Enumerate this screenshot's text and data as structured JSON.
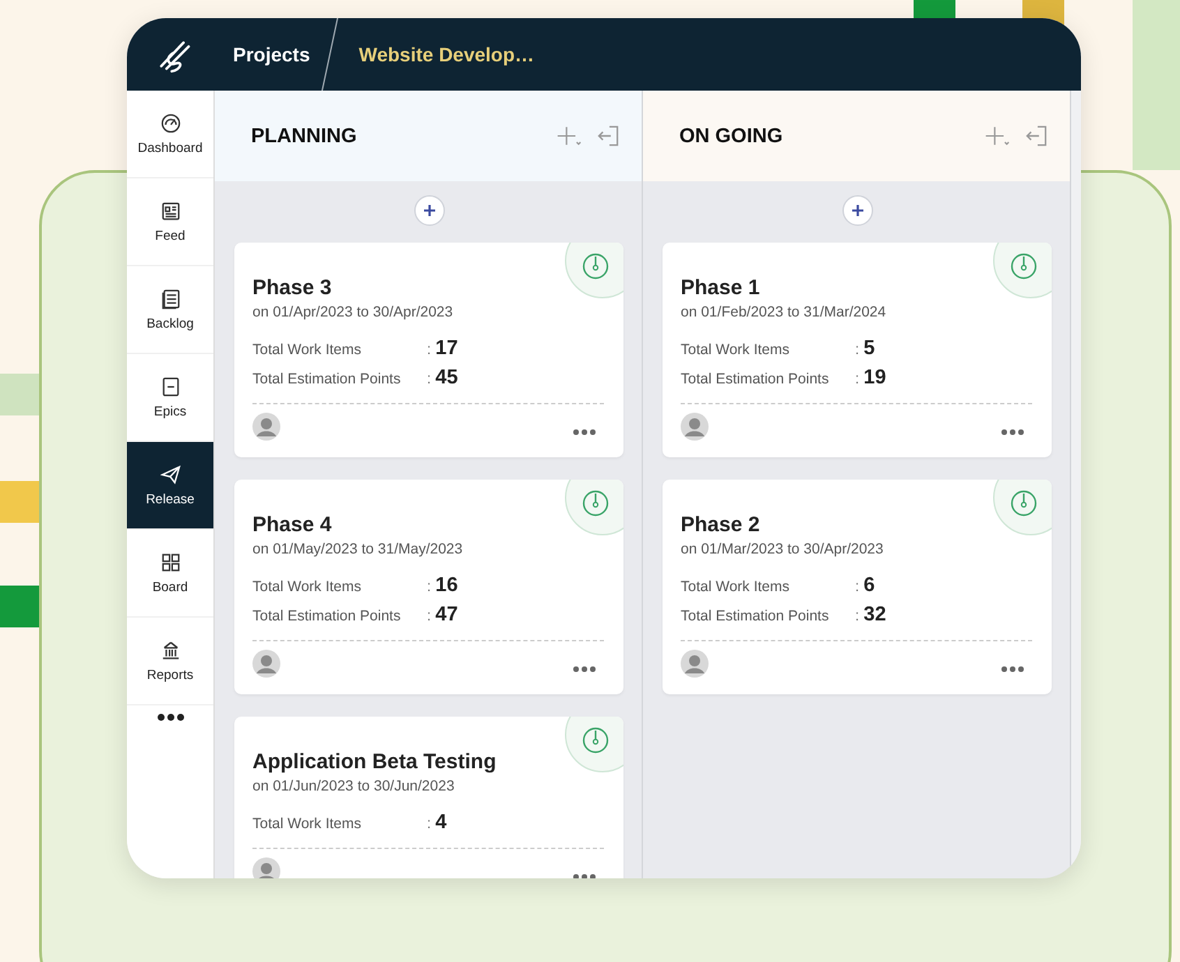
{
  "header": {
    "crumbs": [
      "Projects",
      "Website Develop…"
    ]
  },
  "sidebar": {
    "items": [
      {
        "label": "Dashboard",
        "kind": "dashboard",
        "selected": false
      },
      {
        "label": "Feed",
        "kind": "feed",
        "selected": false
      },
      {
        "label": "Backlog",
        "kind": "backlog",
        "selected": false
      },
      {
        "label": "Epics",
        "kind": "epics",
        "selected": false
      },
      {
        "label": "Release",
        "kind": "release",
        "selected": true
      },
      {
        "label": "Board",
        "kind": "board",
        "selected": false
      },
      {
        "label": "Reports",
        "kind": "reports",
        "selected": false
      }
    ]
  },
  "columns": [
    {
      "title": "PLANNING",
      "cards": [
        {
          "title": "Phase 3",
          "dates": "on 01/Apr/2023 to 30/Apr/2023",
          "stats": [
            {
              "label": "Total Work Items",
              "value": ": **17**"
            },
            {
              "label": "Total Estimation Points",
              "value": ": **45**"
            }
          ]
        },
        {
          "title": "Phase 4",
          "dates": "on 01/May/2023 to 31/May/2023",
          "stats": [
            {
              "label": "Total Work Items",
              "value": ": **16**"
            },
            {
              "label": "Total Estimation Points",
              "value": ": **47**"
            }
          ]
        },
        {
          "title": "Application Beta Testing",
          "dates": "on 01/Jun/2023 to 30/Jun/2023",
          "stats": [
            {
              "label": "Total Work Items",
              "value": ": **4**"
            }
          ]
        }
      ]
    },
    {
      "title": "ON GOING",
      "cards": [
        {
          "title": "Phase 1",
          "dates": "on 01/Feb/2023 to 31/Mar/2024",
          "stats": [
            {
              "label": "Total Work Items",
              "value": ": **5**"
            },
            {
              "label": "Total Estimation Points",
              "value": ": **19**"
            }
          ]
        },
        {
          "title": "Phase 2",
          "dates": "on 01/Mar/2023 to 30/Apr/2023",
          "stats": [
            {
              "label": "Total Work Items",
              "value": ": **6**"
            },
            {
              "label": "Total Estimation Points",
              "value": ": **32**"
            }
          ]
        }
      ]
    }
  ]
}
